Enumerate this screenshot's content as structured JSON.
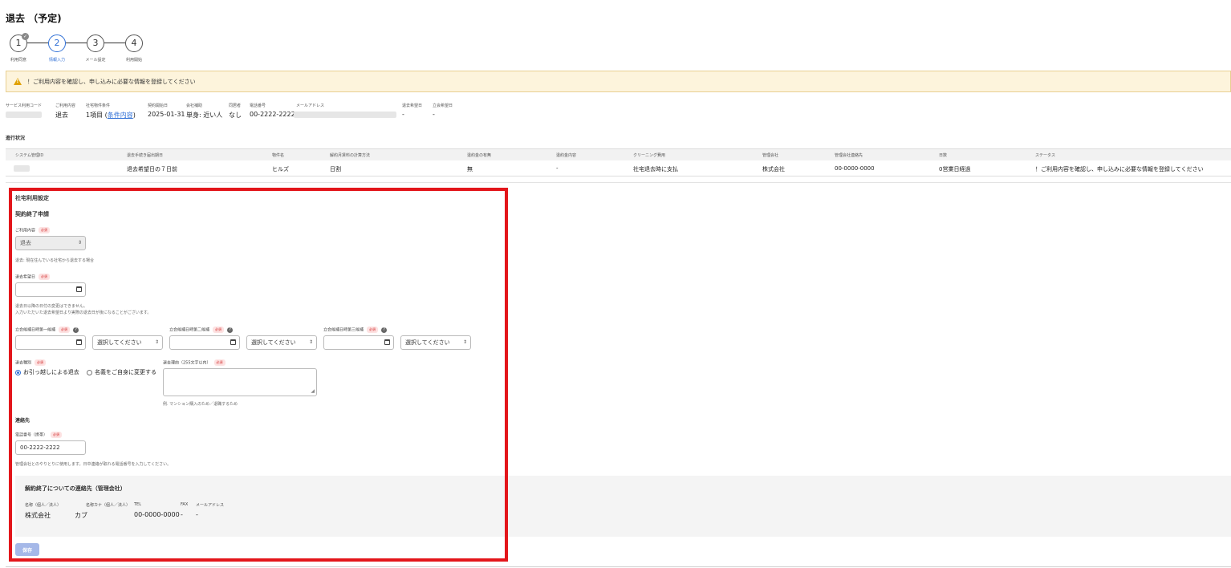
{
  "page": {
    "title": "退去 （予定)"
  },
  "stepper": {
    "steps": [
      {
        "number": "1",
        "label": "利用同意"
      },
      {
        "number": "2",
        "label": "情報入力"
      },
      {
        "number": "3",
        "label": "メール設定"
      },
      {
        "number": "4",
        "label": "利用開始"
      }
    ],
    "current_step": 2
  },
  "alert": {
    "text": "！ご利用内容を確認し、申し込みに必要な情報を登録してください"
  },
  "info": {
    "service_code_label": "サービス利用コード",
    "usage_label": "ご利用内容",
    "usage_value": "退去",
    "conditions_label": "社宅物件条件",
    "conditions_count": "1項目",
    "conditions_link": "条件内容",
    "start_date_label": "契約開始日",
    "start_date_value": "2025-01-31",
    "company_label": "会社補助",
    "company_value": "単身: 近い人",
    "cohabitant_label": "同居者",
    "cohabitant_value": "なし",
    "phone_label": "電話番号",
    "phone_value": "00-2222-2222",
    "email_label": "メールアドレス",
    "moveout_label": "退去希望日",
    "moveout_value": "-",
    "witness_label": "立会希望日",
    "witness_value": "-"
  },
  "progress": {
    "heading": "進行状況",
    "columns": [
      "システム管理ID",
      "退去手続き届出期日",
      "物件名",
      "解約月賃料の計算方法",
      "違約金の有無",
      "違約金内容",
      "クリーニング費用",
      "管理会社",
      "管理会社連絡先",
      "日数",
      "ステータス"
    ],
    "row": [
      "",
      "退去希望日の７日前",
      "ヒルズ",
      "日割",
      "無",
      "-",
      "社宅退去時に支払",
      "株式会社",
      "00-0000-0000",
      "0営業日経過",
      "！ご利用内容を確認し、申し込みに必要な情報を登録してください"
    ]
  },
  "form": {
    "section_title": "社宅利用設定",
    "subsection_title": "契約終了申請",
    "required_badge": "必須",
    "usage_label": "ご利用内容",
    "usage_value": "退去",
    "usage_hint": "退去: 現在住んでいる社宅から退去する場合",
    "moveout_label": "退去希望日",
    "moveout_hint_1": "退去日以降の日付の変更はできません。",
    "moveout_hint_2": "入力いただいた退去希望日より実際の退去日が後になることがございます。",
    "witness_1_label": "立会候補日時第一候補",
    "witness_2_label": "立会候補日時第二候補",
    "witness_3_label": "立会候補日時第三候補",
    "select_placeholder": "選択してください",
    "type_label": "退去種別",
    "type_option_1": "お引っ越しによる退去",
    "type_option_2": "名義をご自身に変更する",
    "reason_label": "退去理由（255文字以内）",
    "reason_hint": "例. マンション購入のため／退職するため",
    "contact_heading": "連絡先",
    "mobile_label": "電話番号（携帯）",
    "mobile_value": "00-2222-2222",
    "mobile_hint": "管理会社とのやりとりに使用します。日中連絡が取れる電話番号を入力してください。",
    "mgmt_heading": "解約終了についての連絡先（管理会社）",
    "mgmt_name_label": "名称（個人／法人）",
    "mgmt_name_value": "株式会社",
    "mgmt_kana_label": "名称カナ（個人／法人）",
    "mgmt_kana_value": "カブ",
    "mgmt_tel_label": "TEL",
    "mgmt_tel_value": "00-0000-0000",
    "mgmt_fax_label": "FAX",
    "mgmt_fax_value": "-",
    "mgmt_email_label": "メールアドレス",
    "mgmt_email_value": "-",
    "save_label": "保存"
  },
  "colors": {
    "accent": "#2f6fd6",
    "highlight": "#e3161b",
    "alert_bg": "#fdf4dc"
  }
}
